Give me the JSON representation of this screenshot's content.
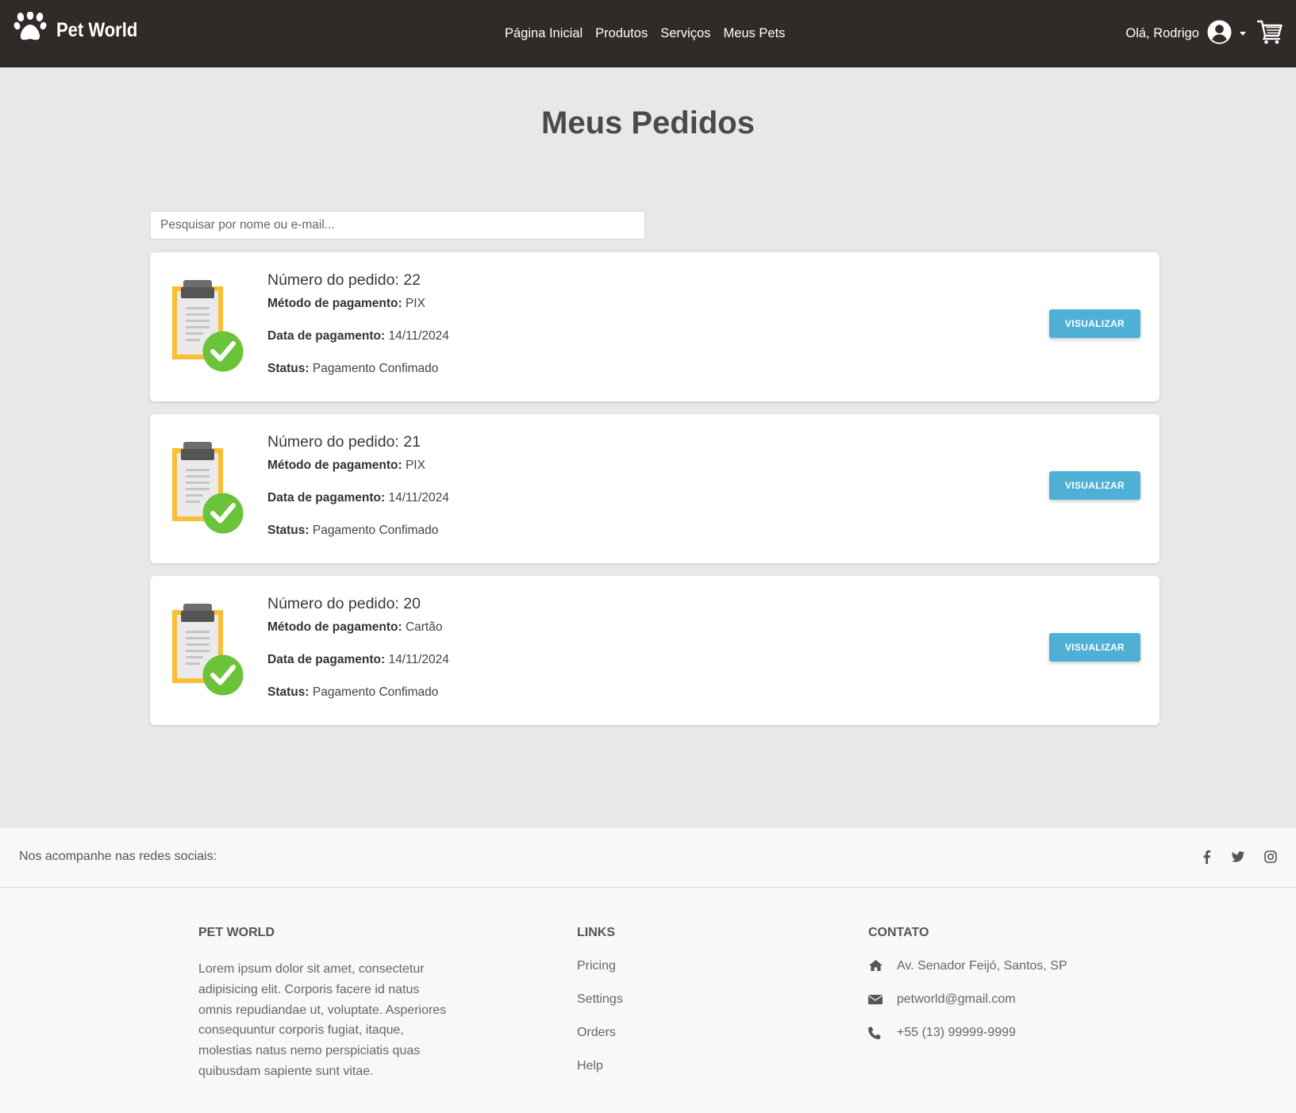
{
  "navbar": {
    "brand": "Pet World",
    "links": [
      "Página Inicial",
      "Produtos",
      "Serviços",
      "Meus Pets"
    ],
    "greeting": "Olá, Rodrigo"
  },
  "page": {
    "title": "Meus Pedidos",
    "search_placeholder": "Pesquisar por nome ou e-mail..."
  },
  "orders": [
    {
      "number_label": "Número do pedido: 22",
      "payment_method_label": "Método de pagamento:",
      "payment_method": "PIX",
      "payment_date_label": "Data de pagamento:",
      "payment_date": "14/11/2024",
      "status_label": "Status:",
      "status": "Pagamento Confimado",
      "button": "VISUALIZAR"
    },
    {
      "number_label": "Número do pedido: 21",
      "payment_method_label": "Método de pagamento:",
      "payment_method": "PIX",
      "payment_date_label": "Data de pagamento:",
      "payment_date": "14/11/2024",
      "status_label": "Status:",
      "status": "Pagamento Confimado",
      "button": "VISUALIZAR"
    },
    {
      "number_label": "Número do pedido: 20",
      "payment_method_label": "Método de pagamento:",
      "payment_method": "Cartão",
      "payment_date_label": "Data de pagamento:",
      "payment_date": "14/11/2024",
      "status_label": "Status:",
      "status": "Pagamento Confimado",
      "button": "VISUALIZAR"
    }
  ],
  "social": {
    "text": "Nos acompanhe nas redes sociais:",
    "icons": [
      "facebook-icon",
      "twitter-icon",
      "instagram-icon"
    ]
  },
  "footer": {
    "about": {
      "heading": "PET WORLD",
      "text": "Lorem ipsum dolor sit amet, consectetur adipisicing elit. Corporis facere id natus omnis repudiandae ut, voluptate. Asperiores consequuntur corporis fugiat, itaque, molestias natus nemo perspiciatis quas quibusdam sapiente sunt vitae."
    },
    "links": {
      "heading": "LINKS",
      "items": [
        "Pricing",
        "Settings",
        "Orders",
        "Help"
      ]
    },
    "contact": {
      "heading": "CONTATO",
      "address": "Av. Senador Feijó, Santos, SP",
      "email": "petworld@gmail.com",
      "phone": "+55 (13) 99999-9999"
    }
  },
  "colors": {
    "navbar_bg": "#302a29",
    "button_bg": "#4fb0d6",
    "page_bg": "#e8e8e8",
    "check_green": "#6bc33a",
    "clipboard_orange": "#fbbd33"
  }
}
